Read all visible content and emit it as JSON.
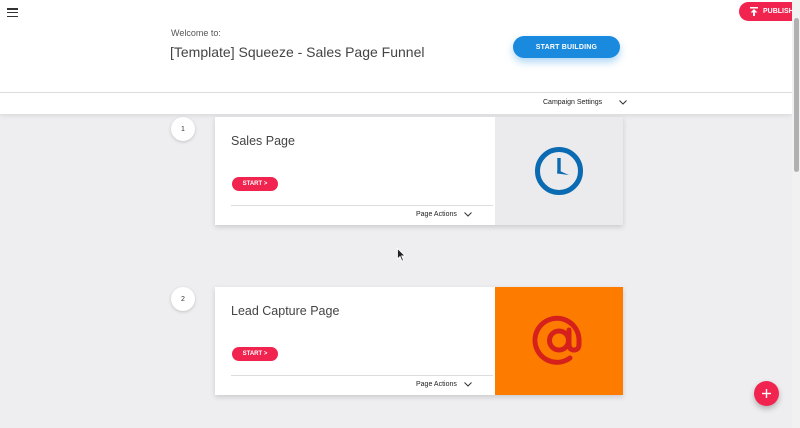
{
  "header": {
    "welcome": "Welcome to:",
    "title": "[Template] Squeeze - Sales Page Funnel",
    "start_building_label": "START BUILDING",
    "publish_label": "PUBLISH"
  },
  "settings_bar": {
    "campaign_settings_label": "Campaign Settings"
  },
  "steps": [
    {
      "number": "1",
      "title": "Sales Page",
      "start_label": "START >",
      "actions_label": "Page Actions",
      "image_icon": "clock-icon"
    },
    {
      "number": "2",
      "title": "Lead Capture Page",
      "start_label": "START >",
      "actions_label": "Page Actions",
      "image_icon": "at-sign-icon"
    }
  ],
  "colors": {
    "accent_pink": "#f0244f",
    "accent_blue": "#1a8adf",
    "clock_blue": "#0a6ab2",
    "orange": "#fd7c00",
    "at_red": "#d6201c"
  },
  "icons": {
    "menu": "hamburger-menu-icon",
    "publish": "upload-arrow-icon",
    "add": "plus-icon",
    "chevron": "chevron-down-icon"
  }
}
